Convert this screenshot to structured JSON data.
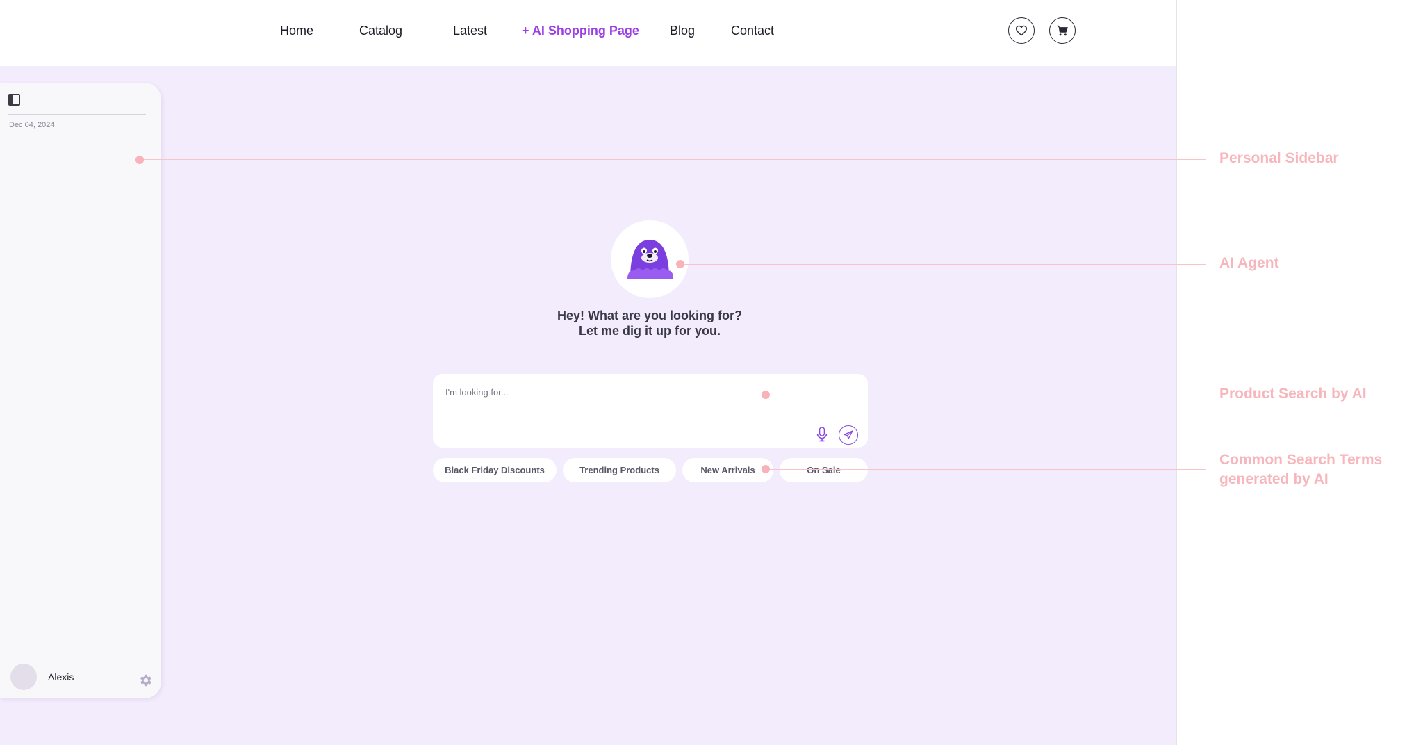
{
  "nav": {
    "items": [
      "Home",
      "Catalog",
      "Latest",
      "+ AI Shopping Page",
      "Blog",
      "Contact"
    ],
    "wishlist_icon": "heart-icon",
    "cart_icon": "cart-icon"
  },
  "sidebar": {
    "toggle_icon": "sidebar-toggle-icon",
    "date": "Dec 04, 2024",
    "user_name": "Alexis",
    "settings_icon": "gear-icon"
  },
  "agent": {
    "greeting_line1": "Hey! What are you looking for?",
    "greeting_line2": "Let me dig it up for you."
  },
  "search": {
    "placeholder": "I'm looking for...",
    "value": "",
    "chips": [
      "Black Friday Discounts",
      "Trending Products",
      "New Arrivals",
      "On Sale"
    ]
  },
  "annotations": {
    "personal_sidebar": "Personal Sidebar",
    "ai_agent": "AI Agent",
    "product_search": "Product Search by AI",
    "common_terms_line1": "Common Search Terms",
    "common_terms_line2": "generated by AI"
  },
  "colors": {
    "accent": "#9b3fe4",
    "background": "#f3ecfd",
    "annotation": "#f7b6bb"
  }
}
